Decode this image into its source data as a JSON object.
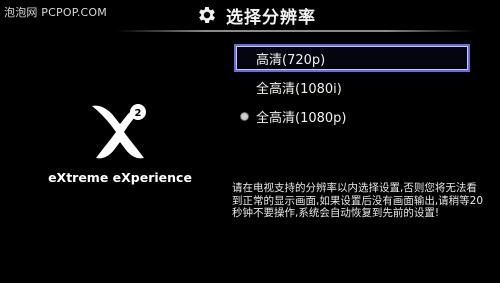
{
  "watermark": "泡泡网 PCPOP.COM",
  "header": {
    "icon": "gear-icon",
    "title": "选择分辨率"
  },
  "logo": {
    "icon": "xbox-360-x-logo",
    "tagline": "eXtreme eXperience"
  },
  "resolutions": [
    {
      "label": "高清(720p)",
      "focused": true,
      "selected": false
    },
    {
      "label": "全高清(1080i)",
      "focused": false,
      "selected": false
    },
    {
      "label": "全高清(1080p)",
      "focused": false,
      "selected": true
    }
  ],
  "notice": "请在电视支持的分辨率以内选择设置,否则您将无法看\n到正常的显示画面,如果设置后没有画面输出,请稍等20\n秒钟不要操作,系统会自动恢复到先前的设置!",
  "colors": {
    "background": "#000000",
    "focus_border": "#6c6cd8",
    "text": "#ffffff"
  }
}
